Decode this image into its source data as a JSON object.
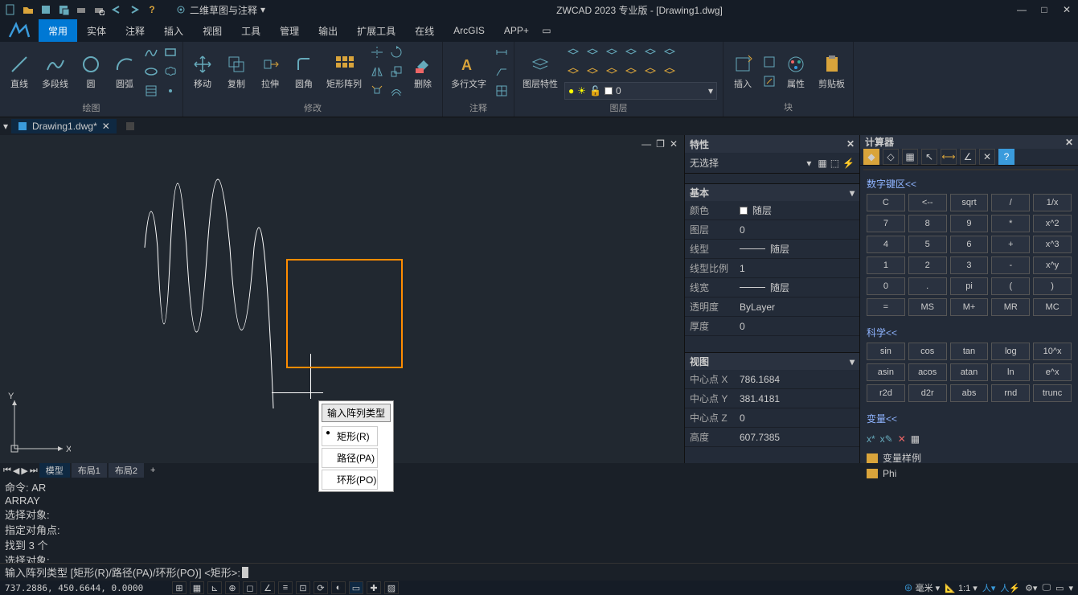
{
  "titlebar": {
    "workspace_label": "二维草图与注释",
    "title": "ZWCAD 2023 专业版 - [Drawing1.dwg]"
  },
  "ribbon_tabs": [
    "常用",
    "实体",
    "注释",
    "插入",
    "视图",
    "工具",
    "管理",
    "输出",
    "扩展工具",
    "在线",
    "ArcGIS",
    "APP+"
  ],
  "ribbon": {
    "group_draw": "绘图",
    "group_modify": "修改",
    "group_annotate": "注释",
    "group_layer": "图层",
    "group_block": "块",
    "line": "直线",
    "polyline": "多段线",
    "circle": "圆",
    "arc": "圆弧",
    "move": "移动",
    "copy": "复制",
    "stretch": "拉伸",
    "fillet": "圆角",
    "rectarray": "矩形阵列",
    "erase": "删除",
    "mtext": "多行文字",
    "layerprops": "图层特性",
    "insert": "插入",
    "attribs": "属性",
    "clipboard": "剪贴板",
    "layer_current": "0"
  },
  "doc_tab": "Drawing1.dwg*",
  "array_popup": {
    "title": "输入阵列类型",
    "options": [
      "矩形(R)",
      "路径(PA)",
      "环形(PO)"
    ]
  },
  "properties_panel": {
    "title": "特性",
    "no_selection": "无选择",
    "section_basic": "基本",
    "rows_basic": {
      "color": {
        "k": "颜色",
        "v": "随层"
      },
      "layer": {
        "k": "图层",
        "v": "0"
      },
      "linetype": {
        "k": "线型",
        "v": "随层"
      },
      "ltscale": {
        "k": "线型比例",
        "v": "1"
      },
      "lineweight": {
        "k": "线宽",
        "v": "随层"
      },
      "transparency": {
        "k": "透明度",
        "v": "ByLayer"
      },
      "thickness": {
        "k": "厚度",
        "v": "0"
      }
    },
    "section_view": "视图",
    "rows_view": {
      "cx": {
        "k": "中心点 X",
        "v": "786.1684"
      },
      "cy": {
        "k": "中心点 Y",
        "v": "381.4181"
      },
      "cz": {
        "k": "中心点 Z",
        "v": "0"
      },
      "height": {
        "k": "高度",
        "v": "607.7385"
      }
    }
  },
  "calculator_panel": {
    "title": "计算器",
    "section_numpad": "数字键区<<",
    "numpad": [
      [
        "C",
        "<--",
        "sqrt",
        "/",
        "1/x"
      ],
      [
        "7",
        "8",
        "9",
        "*",
        "x^2"
      ],
      [
        "4",
        "5",
        "6",
        "+",
        "x^3"
      ],
      [
        "1",
        "2",
        "3",
        "-",
        "x^y"
      ],
      [
        "0",
        ".",
        "pi",
        "(",
        ")"
      ],
      [
        "=",
        "MS",
        "M+",
        "MR",
        "MC"
      ]
    ],
    "section_sci": "科学<<",
    "sci": [
      [
        "sin",
        "cos",
        "tan",
        "log",
        "10^x"
      ],
      [
        "asin",
        "acos",
        "atan",
        "ln",
        "e^x"
      ],
      [
        "r2d",
        "d2r",
        "abs",
        "rnd",
        "trunc"
      ]
    ],
    "section_vars": "变量<<",
    "var_items": [
      "变量样例",
      "Phi"
    ]
  },
  "layout_tabs": [
    "模型",
    "布局1",
    "布局2"
  ],
  "command": {
    "history": "命令: AR\nARRAY\n选择对象:\n指定对角点:\n找到 3 个\n选择对象:",
    "prompt": "输入阵列类型 [矩形(R)/路径(PA)/环形(PO)] <矩形>:"
  },
  "statusbar": {
    "coords": "737.2886, 450.6644, 0.0000",
    "unit": "毫米",
    "scale": "1:1"
  }
}
